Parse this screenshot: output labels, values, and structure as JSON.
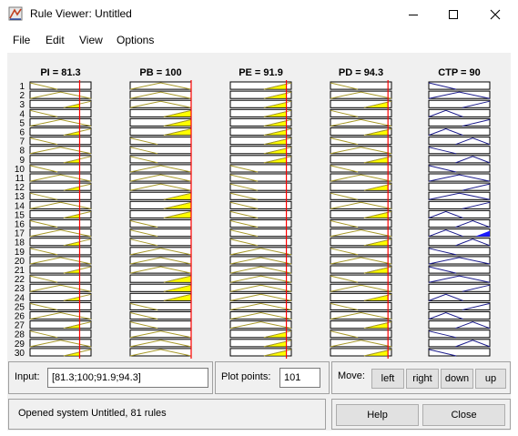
{
  "window": {
    "title": "Rule Viewer: Untitled",
    "icons": [
      "app-icon",
      "minimize-icon",
      "maximize-icon",
      "close-icon"
    ]
  },
  "menu": [
    "File",
    "Edit",
    "View",
    "Options"
  ],
  "columns": [
    {
      "label": "PI = 81.3",
      "value": 81.3,
      "type": "input"
    },
    {
      "label": "PB = 100",
      "value": 100,
      "type": "input"
    },
    {
      "label": "PE = 91.9",
      "value": 91.9,
      "type": "input"
    },
    {
      "label": "PD = 94.3",
      "value": 94.3,
      "type": "input"
    },
    {
      "label": "CTP = 90",
      "value": 90,
      "type": "output"
    }
  ],
  "row_numbers": [
    "1",
    "2",
    "3",
    "4",
    "5",
    "6",
    "7",
    "8",
    "9",
    "10",
    "11",
    "12",
    "13",
    "14",
    "15",
    "16",
    "17",
    "18",
    "19",
    "20",
    "21",
    "22",
    "23",
    "24",
    "25",
    "26",
    "27",
    "28",
    "29",
    "30"
  ],
  "controls": {
    "input_label": "Input:",
    "input_value": "[81.3;100;91.9;94.3]",
    "plot_points_label": "Plot points:",
    "plot_points_value": "101",
    "move_label": "Move:",
    "move_buttons": [
      "left",
      "right",
      "down",
      "up"
    ],
    "help_label": "Help",
    "close_label": "Close"
  },
  "status": "Opened system Untitled, 81 rules",
  "colors": {
    "input_mf": "#a89a2a",
    "output_mf": "#1c1c8c",
    "fill": "#ffff00",
    "indicator": "#ff0000",
    "output_fill": "#1a1aff"
  }
}
